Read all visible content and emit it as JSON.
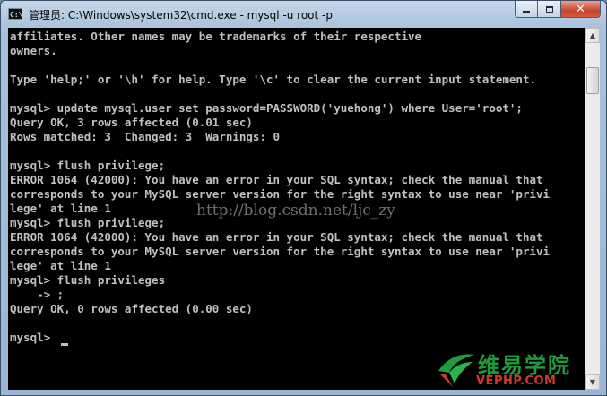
{
  "window": {
    "title": "管理员: C:\\Windows\\system32\\cmd.exe - mysql  -u root  -p",
    "icon_text": "C:\\"
  },
  "console": {
    "lines": [
      "affiliates. Other names may be trademarks of their respective",
      "owners.",
      "",
      "Type 'help;' or '\\h' for help. Type '\\c' to clear the current input statement.",
      "",
      "mysql> update mysql.user set password=PASSWORD('yuehong') where User='root';",
      "Query OK, 3 rows affected (0.01 sec)",
      "Rows matched: 3  Changed: 3  Warnings: 0",
      "",
      "mysql> flush privilege;",
      "ERROR 1064 (42000): You have an error in your SQL syntax; check the manual that",
      "corresponds to your MySQL server version for the right syntax to use near 'privi",
      "lege' at line 1",
      "mysql> flush privilege;",
      "ERROR 1064 (42000): You have an error in your SQL syntax; check the manual that",
      "corresponds to your MySQL server version for the right syntax to use near 'privi",
      "lege' at line 1",
      "mysql> flush privileges",
      "    -> ;",
      "Query OK, 0 rows affected (0.00 sec)",
      "",
      "mysql> "
    ],
    "watermark": "http://blog.csdn.net/ljc_zy"
  },
  "logo": {
    "name": "维易学院",
    "site": "VEPHP.COM"
  },
  "colors": {
    "console_bg": "#000000",
    "console_fg": "#c0c0c0",
    "logo_green": "#1f9a3d",
    "logo_red": "#d03a2a"
  }
}
